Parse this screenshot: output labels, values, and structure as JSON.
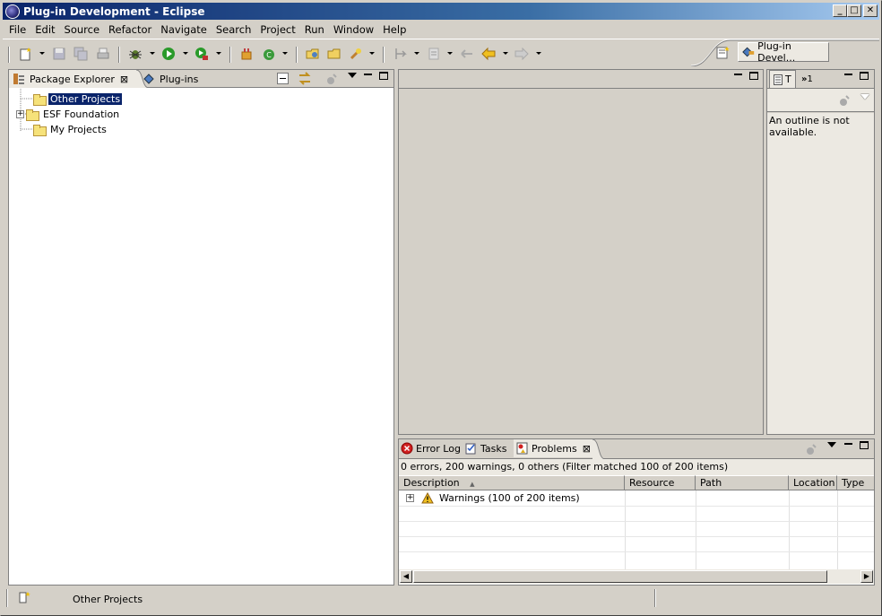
{
  "window": {
    "title": "Plug-in Development - Eclipse"
  },
  "title_buttons": {
    "minimize": "_",
    "maximize": "□",
    "close": "✕"
  },
  "menu": [
    "File",
    "Edit",
    "Source",
    "Refactor",
    "Navigate",
    "Search",
    "Project",
    "Run",
    "Window",
    "Help"
  ],
  "perspective": {
    "label": "Plug-in Devel..."
  },
  "explorer": {
    "tabs": {
      "active": "Package Explorer",
      "inactive": "Plug-ins"
    },
    "tree": [
      {
        "label": "Other Projects",
        "selected": true,
        "expandable": false
      },
      {
        "label": "ESF Foundation",
        "selected": false,
        "expandable": true
      },
      {
        "label": "My Projects",
        "selected": false,
        "expandable": false
      }
    ]
  },
  "outline": {
    "tab1": "T",
    "tab2": "1",
    "message": "An outline is not available."
  },
  "bottom": {
    "tabs": [
      "Error Log",
      "Tasks",
      "Problems"
    ],
    "active_tab": "Problems",
    "summary": "0 errors, 200 warnings, 0 others (Filter matched 100 of 200 items)",
    "columns": [
      "Description",
      "Resource",
      "Path",
      "Location",
      "Type"
    ],
    "rows": [
      {
        "description": "Warnings (100 of 200 items)"
      }
    ]
  },
  "status": {
    "text": "Other Projects"
  },
  "colors": {
    "title_start": "#0a246a",
    "title_end": "#a6caf0",
    "selection": "#0a246a",
    "chrome": "#d4d0c8"
  }
}
